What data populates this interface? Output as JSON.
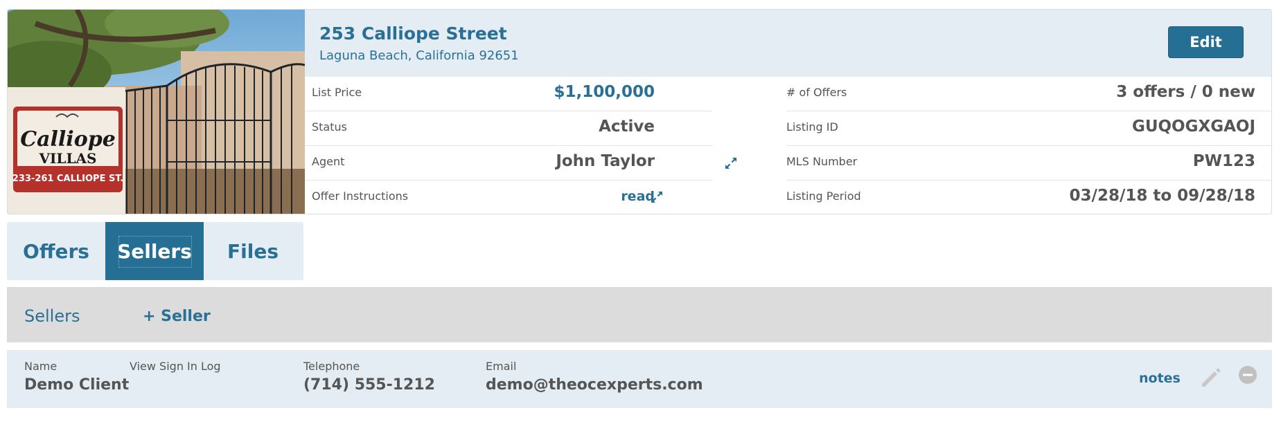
{
  "listing": {
    "address_line1": "253 Calliope Street",
    "address_line2": "Laguna Beach, California  92651",
    "edit_label": "Edit",
    "photo_sign_text": [
      "Calliope",
      "VILLAS",
      "233-261 CALLIOPE ST."
    ],
    "left_details": [
      {
        "label": "List Price",
        "value": "$1,100,000"
      },
      {
        "label": "Status",
        "value": "Active"
      },
      {
        "label": "Agent",
        "value": "John Taylor"
      },
      {
        "label": "Offer Instructions",
        "value": "read"
      }
    ],
    "right_details": [
      {
        "label": "# of Offers",
        "value": "3 offers / 0 new"
      },
      {
        "label": "Listing ID",
        "value": "GUQOGXGAOJ"
      },
      {
        "label": "MLS Number",
        "value": "PW123"
      },
      {
        "label": "Listing Period",
        "value": "03/28/18 to 09/28/18"
      }
    ]
  },
  "tabs": [
    {
      "label": "Offers",
      "active": false
    },
    {
      "label": "Sellers",
      "active": true
    },
    {
      "label": "Files",
      "active": false
    }
  ],
  "sellers_section": {
    "title": "Sellers",
    "add_label": "+ Seller"
  },
  "seller": {
    "name_label": "Name",
    "name": "Demo Client",
    "signin_label": "View Sign In Log",
    "phone_label": "Telephone",
    "phone": "(714) 555-1212",
    "email_label": "Email",
    "email": "demo@theocexperts.com",
    "notes_label": "notes"
  },
  "icons": {
    "expand": "expand-icon",
    "edit": "pencil-icon",
    "remove": "minus-circle-icon"
  },
  "colors": {
    "accent": "#2a7096",
    "button": "#246f93",
    "header_bg": "#e3edf3",
    "section_bg": "#dcdcdc"
  }
}
